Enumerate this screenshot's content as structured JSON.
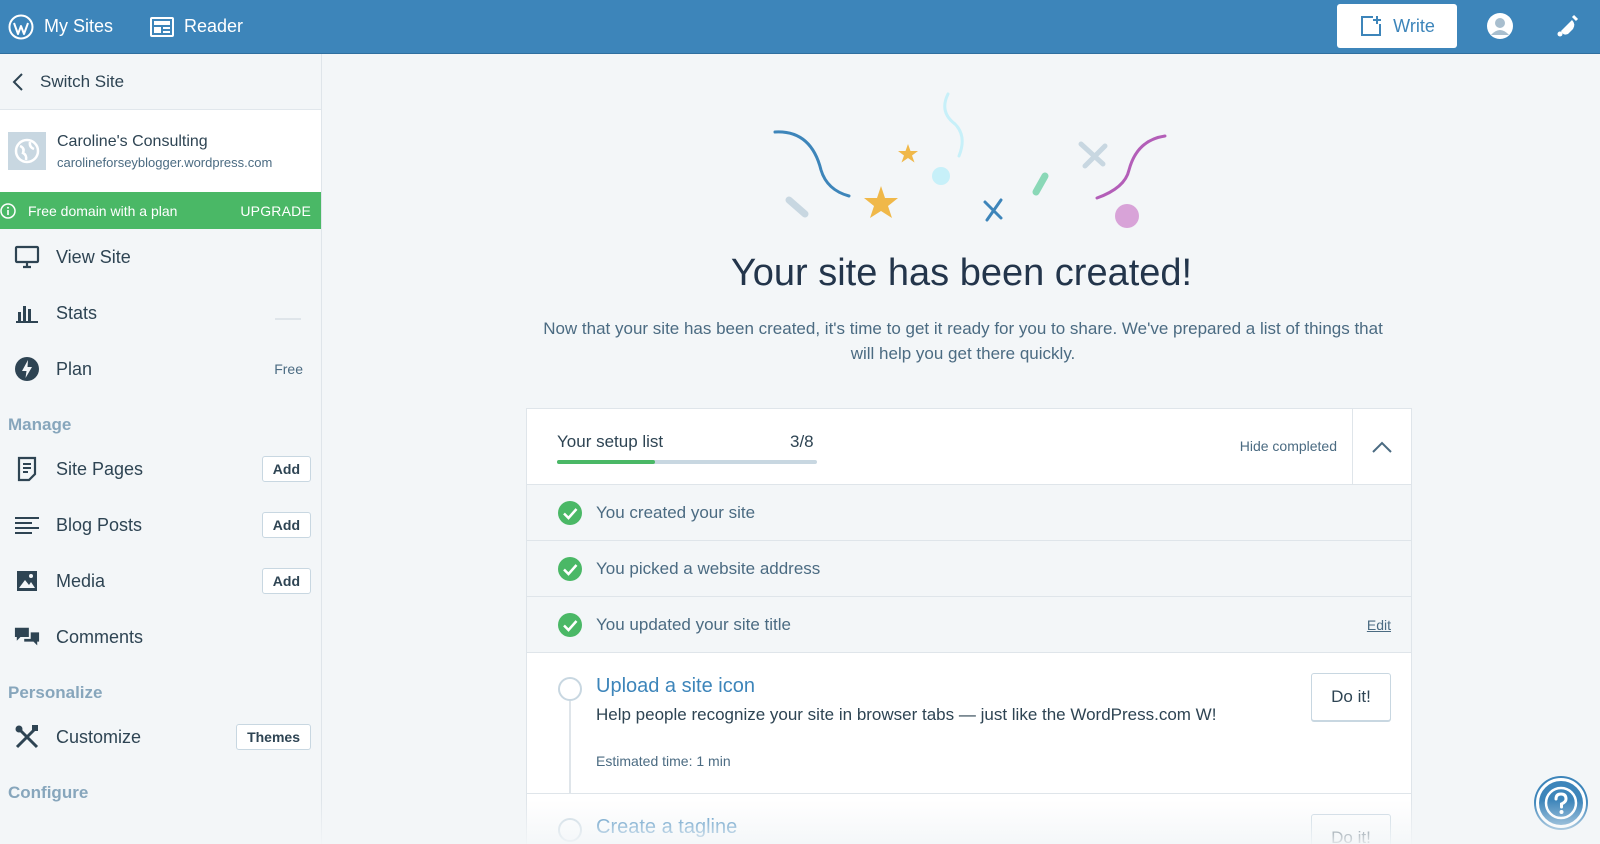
{
  "topbar": {
    "my_sites": "My Sites",
    "reader": "Reader",
    "write": "Write"
  },
  "sidebar": {
    "switch_site": "Switch Site",
    "site_name": "Caroline's Consulting",
    "site_url": "carolineforseyblogger.wordpress.com",
    "upgrade_text": "Free domain with a plan",
    "upgrade_cta": "UPGRADE",
    "view_site": "View Site",
    "stats": "Stats",
    "plan": "Plan",
    "plan_value": "Free",
    "manage_head": "Manage",
    "site_pages": "Site Pages",
    "blog_posts": "Blog Posts",
    "media": "Media",
    "comments": "Comments",
    "add": "Add",
    "personalize_head": "Personalize",
    "customize": "Customize",
    "themes": "Themes",
    "configure_head": "Configure"
  },
  "main": {
    "title": "Your site has been created!",
    "subtitle": "Now that your site has been created, it's time to get it ready for you to share. We've prepared a list of things that will help you get there quickly.",
    "setup_label": "Your setup list",
    "setup_count": "3/8",
    "progress_fraction": 0.375,
    "hide_completed": "Hide completed",
    "tasks_done": [
      {
        "text": "You created your site"
      },
      {
        "text": "You picked a website address"
      },
      {
        "text": "You updated your site title",
        "action": "Edit"
      }
    ],
    "task_open": {
      "title": "Upload a site icon",
      "desc": "Help people recognize your site in browser tabs — just like the WordPress.com W!",
      "time": "Estimated time: 1 min",
      "button": "Do it!"
    },
    "task_next": {
      "title": "Create a tagline",
      "button": "Do it!"
    }
  },
  "colors": {
    "topbar": "#3d85ba",
    "upgrade_green": "#4ab866",
    "text_dark": "#2e4453",
    "text_muted": "#4b6b82",
    "section_head": "#87a6bc"
  }
}
